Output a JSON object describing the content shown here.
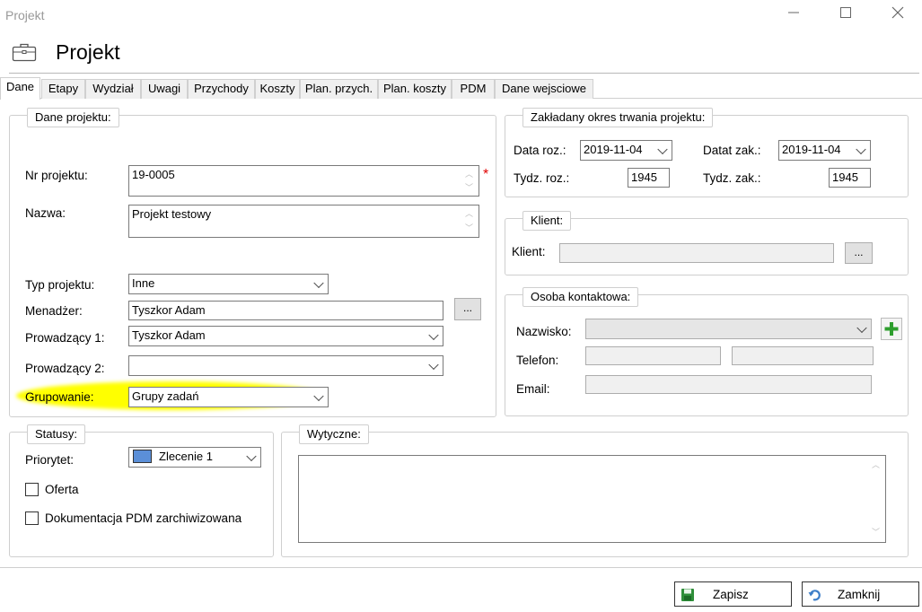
{
  "window": {
    "title": "Projekt",
    "minimize": "—",
    "maximize": "☐",
    "close": "✕"
  },
  "header": {
    "title": "Projekt",
    "icon": "briefcase-icon"
  },
  "tabs": [
    "Dane",
    "Etapy",
    "Wydział",
    "Uwagi",
    "Przychody",
    "Koszty",
    "Plan. przych.",
    "Plan. koszty",
    "PDM",
    "Dane wejsciowe"
  ],
  "dane_projektu": {
    "legend": "Dane projektu:",
    "nr_label": "Nr projektu:",
    "nr_value": "19-0005",
    "required_marker": "*",
    "nazwa_label": "Nazwa:",
    "nazwa_value": "Projekt testowy",
    "typ_label": "Typ projektu:",
    "typ_value": "Inne",
    "menadzer_label": "Menadżer:",
    "menadzer_value": "Tyszkor Adam",
    "prow1_label": "Prowadzący 1:",
    "prow1_value": "Tyszkor Adam",
    "prow2_label": "Prowadzący 2:",
    "prow2_value": "",
    "grup_label": "Grupowanie:",
    "grup_value": "Grupy zadań",
    "highlight_color": "#ffff00"
  },
  "okres": {
    "legend": "Zakładany okres trwania projektu:",
    "data_roz_label": "Data roz.:",
    "data_roz_value": "2019-11-04",
    "data_zak_label": "Datat zak.:",
    "data_zak_value": "2019-11-04",
    "tydz_roz_label": "Tydz. roz.:",
    "tydz_roz_value": "1945",
    "tydz_zak_label": "Tydz. zak.:",
    "tydz_zak_value": "1945"
  },
  "klient": {
    "legend": "Klient:",
    "label": "Klient:",
    "value": "",
    "browse": "..."
  },
  "osoba": {
    "legend": "Osoba kontaktowa:",
    "nazwisko_label": "Nazwisko:",
    "nazwisko_value": "",
    "telefon_label": "Telefon:",
    "telefon_value1": "",
    "telefon_value2": "",
    "email_label": "Email:",
    "email_value": "",
    "add_color": "#2e9e2e"
  },
  "statusy": {
    "legend": "Statusy:",
    "priorytet_label": "Priorytet:",
    "priorytet_value": "Zlecenie 1",
    "priorytet_color": "#5b8fd8",
    "oferta_label": "Oferta",
    "oferta_checked": false,
    "pdm_label": "Dokumentacja PDM zarchiwizowana",
    "pdm_checked": false
  },
  "wytyczne": {
    "legend": "Wytyczne:",
    "value": ""
  },
  "buttons": {
    "zapisz": "Zapisz",
    "zamknij": "Zamknij"
  },
  "menadzer_browse": "..."
}
